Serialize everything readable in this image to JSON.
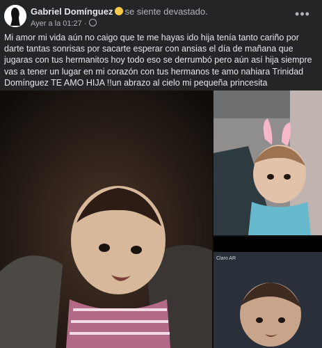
{
  "post": {
    "author": "Gabriel Domínguez",
    "feeling": "se siente devastado.",
    "timestamp": "Ayer a la 01:27 ·",
    "text": "Mi amor mi vida aún no caigo que te me hayas ido hija tenía tanto cariño por darte tantas sonrisas por sacarte  esperar con ansias el día de mañana que jugaras con tus hermanitos hoy todo eso se derrumbó pero aún así hija siempre vas a tener un lugar en mi corazón con tus hermanos  te amo nahiara Trinidad Domínguez TE AMO HIJA !!un abrazo al cielo mi pequeña princesita",
    "more_label": "•••"
  },
  "photos": [
    {
      "kind": "baby-smiling-night"
    },
    {
      "kind": "baby-bunny-filter"
    },
    {
      "kind": "baby-phone-screenshot",
      "status_text": "Claro AR"
    }
  ]
}
